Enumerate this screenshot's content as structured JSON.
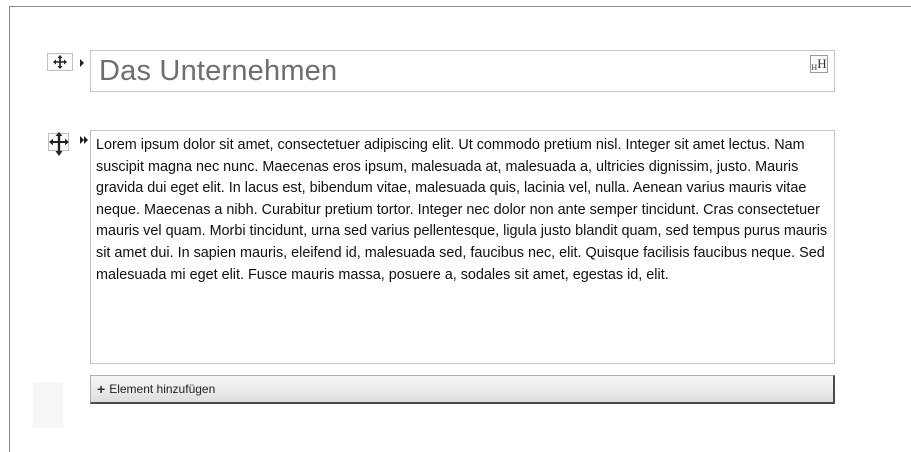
{
  "heading_block": {
    "title": "Das Unternehmen",
    "heading_badge": "H"
  },
  "text_block": {
    "body": "Lorem ipsum dolor sit amet, consectetuer adipiscing elit. Ut commodo pretium nisl. Integer sit amet lectus. Nam suscipit magna nec nunc. Maecenas eros ipsum, malesuada at, malesuada a, ultricies dignissim, justo. Mauris gravida dui eget elit. In lacus est, bibendum vitae, malesuada quis, lacinia vel, nulla. Aenean varius mauris vitae neque. Maecenas a nibh. Curabitur pretium tortor. Integer nec dolor non ante semper tincidunt. Cras consectetuer mauris vel quam. Morbi tincidunt, urna sed varius pellentesque, ligula justo blandit quam, sed tempus purus mauris sit amet dui. In sapien mauris, eleifend id, malesuada sed, faucibus nec, elit. Quisque facilisis faucibus neque. Sed malesuada mi eget elit. Fusce mauris massa, posuere a, sodales sit amet, egestas id, elit."
  },
  "add_element": {
    "label": "Element hinzufügen",
    "icon": "plus-icon"
  },
  "icons": {
    "move_handle": "move-arrows-icon",
    "expand": "arrow-right-icon"
  }
}
